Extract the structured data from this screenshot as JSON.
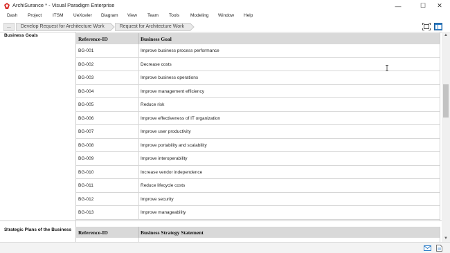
{
  "window": {
    "title": "ArchiSurance * - Visual Paradigm Enterprise",
    "minimize_glyph": "—",
    "maximize_glyph": "☐",
    "close_glyph": "✕"
  },
  "menu": {
    "items": [
      "Dash",
      "Project",
      "ITSM",
      "UeXceler",
      "Diagram",
      "View",
      "Team",
      "Tools",
      "Modeling",
      "Window",
      "Help"
    ]
  },
  "breadcrumb": {
    "overflow": "...",
    "items": [
      "Develop Request for Architecture Work",
      "Request for Architecture Work"
    ]
  },
  "sections": {
    "business_goals": {
      "label": "Business Goals",
      "columns": [
        "Reference-ID",
        "Business Goal"
      ],
      "rows": [
        {
          "id": "BG-001",
          "goal": "Improve business process performance"
        },
        {
          "id": "BG-002",
          "goal": "Decrease costs"
        },
        {
          "id": "BG-003",
          "goal": "Improve business operations"
        },
        {
          "id": "BG-004",
          "goal": "Improve management efficiency"
        },
        {
          "id": "BG-005",
          "goal": "Reduce risk"
        },
        {
          "id": "BG-006",
          "goal": "Improve effectiveness of IT organization"
        },
        {
          "id": "BG-007",
          "goal": "Improve user productivity"
        },
        {
          "id": "BG-008",
          "goal": "Improve portability and scalability"
        },
        {
          "id": "BG-009",
          "goal": "Improve interoperability"
        },
        {
          "id": "BG-010",
          "goal": "Increase vendor independence"
        },
        {
          "id": "BG-011",
          "goal": "Reduce lifecycle costs"
        },
        {
          "id": "BG-012",
          "goal": "Improve security"
        },
        {
          "id": "BG-013",
          "goal": "Improve manageability"
        }
      ]
    },
    "strategic_plans": {
      "label": "Strategic Plans of the Business",
      "columns": [
        "Reference-ID",
        "Business Strategy Statement"
      ]
    }
  },
  "icons": {
    "app": "visual-paradigm-logo-icon",
    "nav_right_1": "fit-to-screen-icon",
    "nav_right_2": "panel-layout-icon",
    "status_1": "mail-icon",
    "status_2": "document-icon"
  },
  "colors": {
    "header_bg": "#d9d9d9",
    "app_icon": "#d9302c",
    "accent_blue": "#2f7fc9"
  }
}
